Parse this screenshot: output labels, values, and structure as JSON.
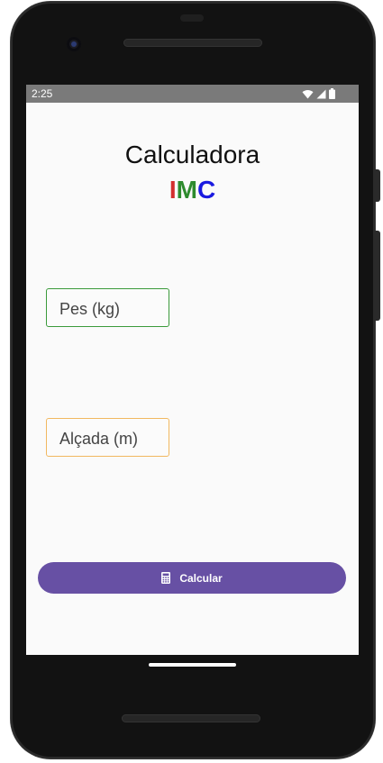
{
  "status_bar": {
    "time": "2:25",
    "icons": [
      "wifi-icon",
      "cellular-signal-icon",
      "battery-icon"
    ]
  },
  "app": {
    "title": "Calculadora",
    "subtitle_letters": [
      {
        "char": "I",
        "color": "#d32f2f"
      },
      {
        "char": "M",
        "color": "#2e8b2e"
      },
      {
        "char": "C",
        "color": "#1a1ae0"
      }
    ]
  },
  "form": {
    "weight_placeholder": "Pes (kg)",
    "height_placeholder": "Alçada (m)"
  },
  "button": {
    "label": "Calcular",
    "icon": "calculator-icon",
    "color": "#6750a4"
  }
}
